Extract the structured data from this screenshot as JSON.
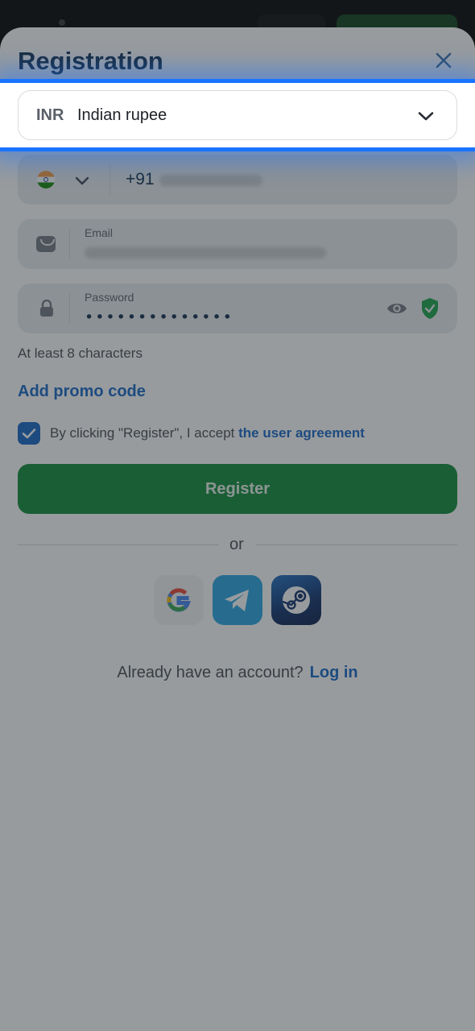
{
  "title": "Registration",
  "currency": {
    "code": "INR",
    "name": "Indian rupee"
  },
  "phone": {
    "country_code": "+91"
  },
  "email": {
    "label": "Email"
  },
  "password": {
    "label": "Password",
    "masked_value": "••••••••••••••",
    "hint": "At least 8 characters"
  },
  "promo_link": "Add promo code",
  "agreement": {
    "text": "By clicking \"Register\", I accept ",
    "link": "the user agreement",
    "checked": true
  },
  "register_button": "Register",
  "divider_text": "or",
  "social": [
    "google-icon",
    "telegram-icon",
    "steam-icon"
  ],
  "login_prompt": {
    "text": "Already have an account?",
    "link": "Log in"
  },
  "colors": {
    "accent": "#1566c8",
    "register_green": "#0f8a3a",
    "highlight": "#1a73ff"
  }
}
